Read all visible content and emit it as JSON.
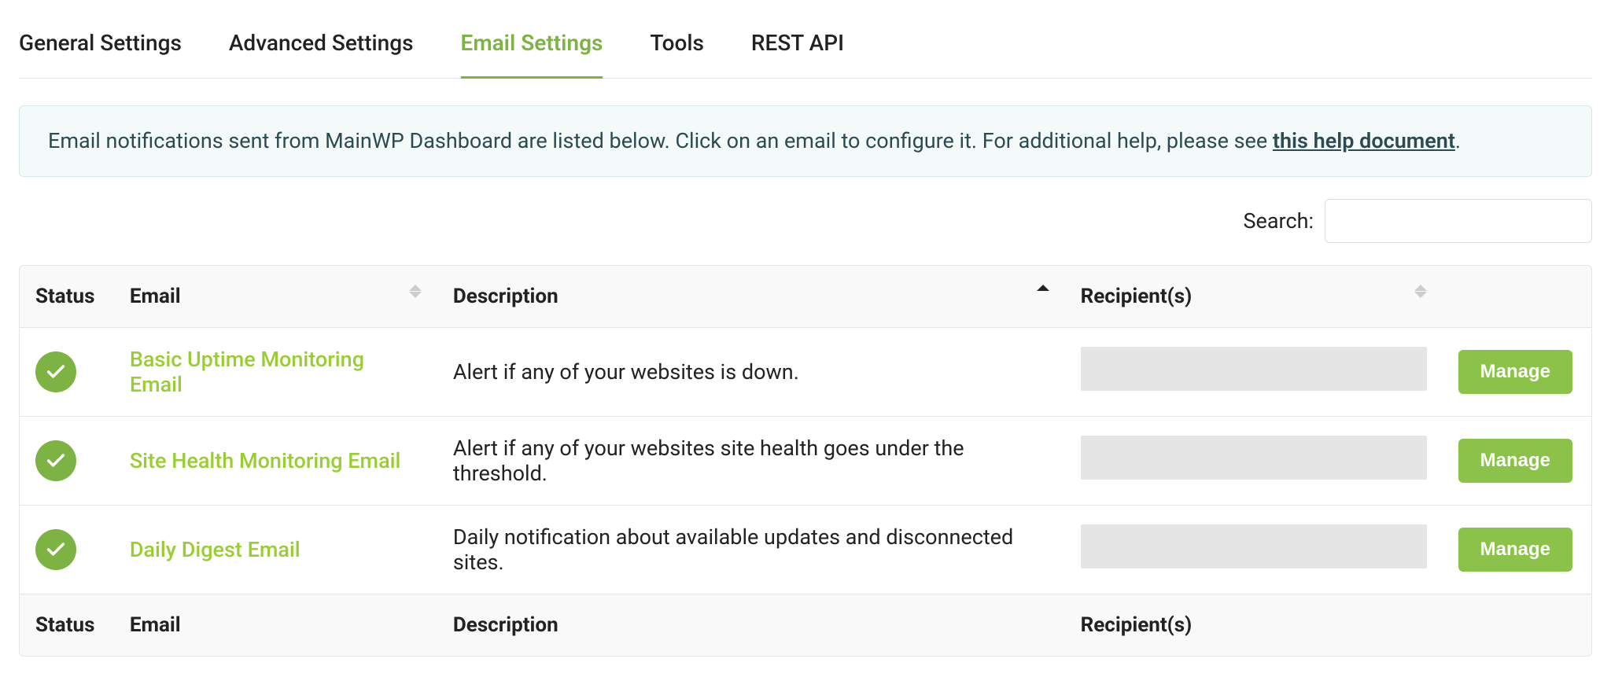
{
  "tabs": [
    {
      "label": "General Settings",
      "active": false
    },
    {
      "label": "Advanced Settings",
      "active": false
    },
    {
      "label": "Email Settings",
      "active": true
    },
    {
      "label": "Tools",
      "active": false
    },
    {
      "label": "REST API",
      "active": false
    }
  ],
  "info": {
    "text_before": "Email notifications sent from MainWP Dashboard are listed below. Click on an email to configure it. For additional help, please see ",
    "link_text": "this help document",
    "text_after": "."
  },
  "search": {
    "label": "Search:",
    "value": ""
  },
  "columns": {
    "status": "Status",
    "email": "Email",
    "description": "Description",
    "recipients": "Recipient(s)"
  },
  "rows": [
    {
      "email": "Basic Uptime Monitoring Email",
      "description": "Alert if any of your websites is down.",
      "manage": "Manage"
    },
    {
      "email": "Site Health Monitoring Email",
      "description": "Alert if any of your websites site health goes under the threshold.",
      "manage": "Manage"
    },
    {
      "email": "Daily Digest Email",
      "description": "Daily notification about available updates and disconnected sites.",
      "manage": "Manage"
    }
  ]
}
